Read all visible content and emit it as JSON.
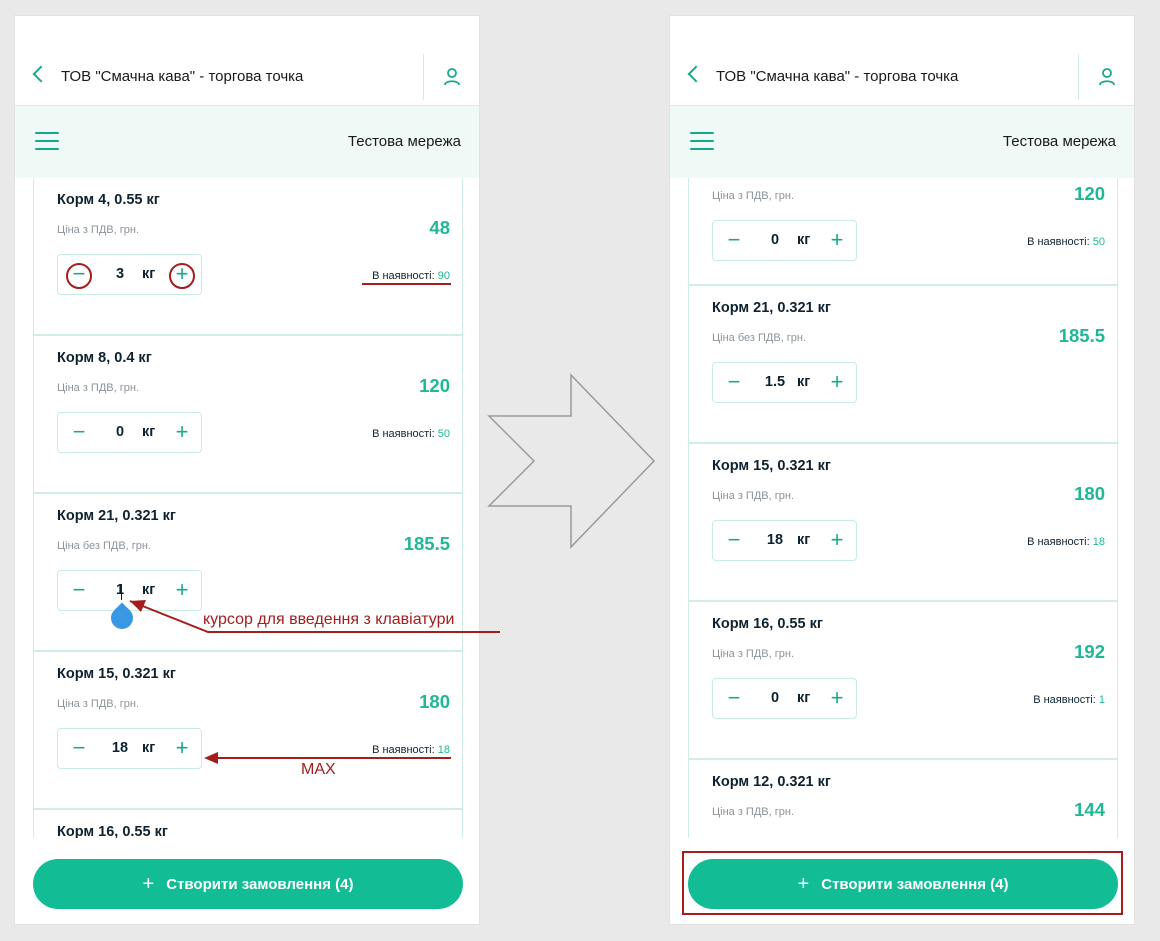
{
  "header": {
    "store_title": "ТОВ \"Смачна кава\" - торгова точка",
    "network_label": "Тестова мережа"
  },
  "order_button": {
    "icon": "plus-icon",
    "label": "Створити замовлення (4)"
  },
  "stock_prefix": "В наявності:",
  "unit": "кг",
  "left_screen": {
    "products": [
      {
        "name": "Корм 4, 0.55 кг",
        "price_label": "Ціна з ПДВ, грн.",
        "price": "48",
        "quantity": "3",
        "stock": "90"
      },
      {
        "name": "Корм 8, 0.4 кг",
        "price_label": "Ціна з ПДВ, грн.",
        "price": "120",
        "quantity": "0",
        "stock": "50"
      },
      {
        "name": "Корм 21, 0.321 кг",
        "price_label": "Ціна без ПДВ, грн.",
        "price": "185.5",
        "quantity": "1"
      },
      {
        "name": "Корм 15, 0.321 кг",
        "price_label": "Ціна з ПДВ, грн.",
        "price": "180",
        "quantity": "18",
        "stock": "18"
      },
      {
        "name": "Корм 16, 0.55 кг"
      }
    ]
  },
  "right_screen": {
    "products": [
      {
        "price_label": "Ціна з ПДВ, грн.",
        "price": "120",
        "quantity": "0",
        "stock": "50"
      },
      {
        "name": "Корм 21, 0.321 кг",
        "price_label": "Ціна без ПДВ, грн.",
        "price": "185.5",
        "quantity": "1.5"
      },
      {
        "name": "Корм 15, 0.321 кг",
        "price_label": "Ціна з ПДВ, грн.",
        "price": "180",
        "quantity": "18",
        "stock": "18"
      },
      {
        "name": "Корм 16, 0.55 кг",
        "price_label": "Ціна з ПДВ, грн.",
        "price": "192",
        "quantity": "0",
        "stock": "1"
      },
      {
        "name": "Корм 12, 0.321 кг",
        "price_label": "Ціна з ПДВ, грн.",
        "price": "144"
      }
    ]
  },
  "annotations": {
    "cursor_note": "курсор для введення з клавіатури",
    "max_note": "MAX"
  },
  "colors": {
    "accent": "#12bd96",
    "annotation": "#a51d1d",
    "cursor_drop": "#3a97e3"
  }
}
